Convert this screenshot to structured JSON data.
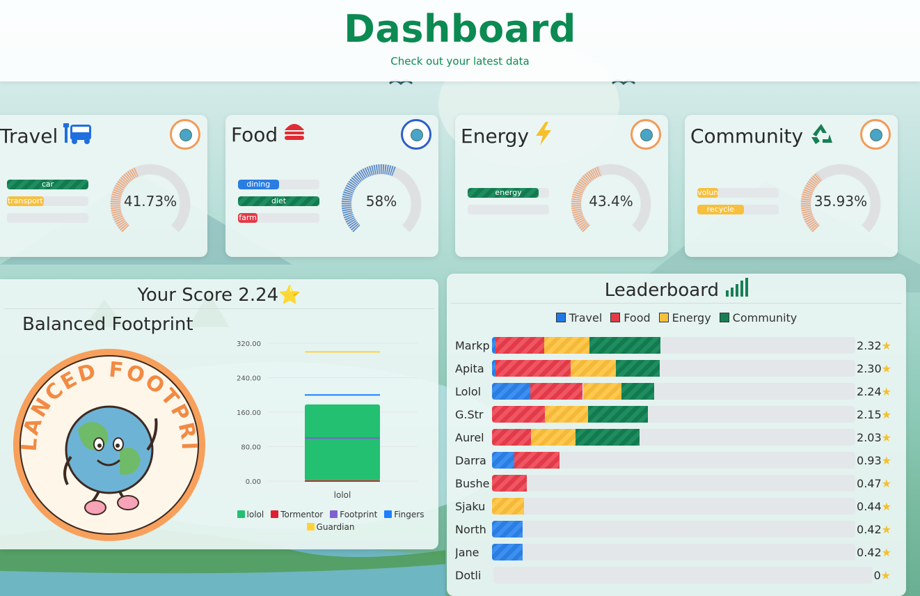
{
  "header": {
    "title": "Dashboard",
    "subtitle": "Check out your latest data"
  },
  "categories": [
    {
      "title": "Travel",
      "icon": "bus-icon",
      "badge": "balanced-footprint-badge",
      "percent_label": "41.73%",
      "percent": 41.73,
      "bars": [
        {
          "label": "car",
          "fill": 1.0,
          "style": "stripe-green"
        },
        {
          "label": "transport",
          "fill": 0.45,
          "style": "solid-yellow"
        },
        {
          "label": "",
          "fill": 0,
          "style": "solid-green"
        }
      ]
    },
    {
      "title": "Food",
      "icon": "burger-icon",
      "badge": "green-fingers-badge",
      "percent_label": "58%",
      "percent": 58,
      "bars": [
        {
          "label": "dining",
          "fill": 0.5,
          "style": "solid-blue"
        },
        {
          "label": "diet",
          "fill": 1.0,
          "style": "stripe-green"
        },
        {
          "label": "farm",
          "fill": 0.24,
          "style": "solid-red"
        }
      ]
    },
    {
      "title": "Energy",
      "icon": "lightning-icon",
      "badge": "balanced-footprint-badge",
      "percent_label": "43.4%",
      "percent": 43.4,
      "bars": [
        {
          "label": "energy",
          "fill": 0.87,
          "style": "stripe-green"
        },
        {
          "label": "",
          "fill": 0,
          "style": "solid-green"
        }
      ]
    },
    {
      "title": "Community",
      "icon": "recycle-icon",
      "badge": "balanced-footprint-badge",
      "percent_label": "35.93%",
      "percent": 35.93,
      "bars": [
        {
          "label": "volun",
          "fill": 0.26,
          "style": "solid-yellow"
        },
        {
          "label": "recycle",
          "fill": 0.57,
          "style": "solid-yellow"
        }
      ]
    }
  ],
  "score": {
    "title": "Your Score 2.24",
    "star": "⭐",
    "badge_name": "Balanced Footprint",
    "logo_text": "BALANCED FOOTPRINT"
  },
  "chart_data": {
    "type": "bar",
    "categories": [
      "lolol"
    ],
    "ylim": [
      0,
      320
    ],
    "yticks": [
      "320.00",
      "240.00",
      "160.00",
      "80.00",
      "0.00"
    ],
    "series": [
      {
        "name": "lolol",
        "values": [
          178
        ],
        "color": "#22c070",
        "kind": "bar"
      },
      {
        "name": "Tormentor",
        "values": [
          0
        ],
        "color": "#e01e2f",
        "kind": "line"
      },
      {
        "name": "Footprint",
        "values": [
          100
        ],
        "color": "#8060d0",
        "kind": "line"
      },
      {
        "name": "Fingers",
        "values": [
          200
        ],
        "color": "#1e80ff",
        "kind": "line"
      },
      {
        "name": "Guardian",
        "values": [
          300
        ],
        "color": "#ffd23c",
        "kind": "line"
      }
    ]
  },
  "leaderboard": {
    "title": "Leaderboard",
    "legend": [
      {
        "label": "Travel",
        "color": "#1e78e6"
      },
      {
        "label": "Food",
        "color": "#e23a48"
      },
      {
        "label": "Energy",
        "color": "#f7bf3e"
      },
      {
        "label": "Community",
        "color": "#177f54"
      }
    ],
    "rows": [
      {
        "name": "Markp",
        "score": "2.32",
        "segs": [
          0.01,
          0.134,
          0.125,
          0.195
        ]
      },
      {
        "name": "Apita",
        "score": "2.30",
        "segs": [
          0.01,
          0.206,
          0.125,
          0.12
        ]
      },
      {
        "name": "Lolol",
        "score": "2.24",
        "segs": [
          0.105,
          0.145,
          0.107,
          0.09
        ]
      },
      {
        "name": "G.Str",
        "score": "2.15",
        "segs": [
          0,
          0.145,
          0.12,
          0.165
        ]
      },
      {
        "name": "Aurel",
        "score": "2.03",
        "segs": [
          0,
          0.108,
          0.122,
          0.177
        ]
      },
      {
        "name": "Darra",
        "score": "0.93",
        "segs": [
          0.062,
          0.124,
          0,
          0
        ]
      },
      {
        "name": "Bushe",
        "score": "0.47",
        "segs": [
          0,
          0.096,
          0,
          0
        ]
      },
      {
        "name": "Sjaku",
        "score": "0.44",
        "segs": [
          0,
          0,
          0.089,
          0
        ]
      },
      {
        "name": "North",
        "score": "0.42",
        "segs": [
          0.085,
          0,
          0,
          0
        ]
      },
      {
        "name": "Jane",
        "score": "0.42",
        "segs": [
          0.085,
          0,
          0,
          0
        ]
      },
      {
        "name": "Dotli",
        "score": "0",
        "segs": [
          0,
          0,
          0,
          0
        ]
      }
    ]
  }
}
